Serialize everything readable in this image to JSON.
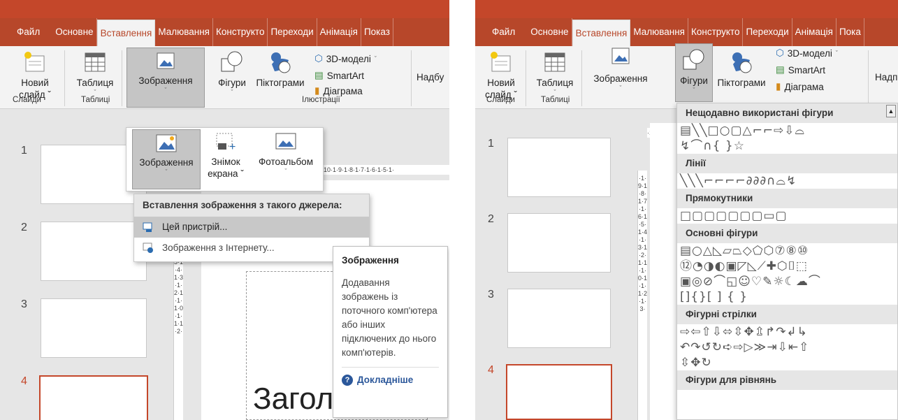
{
  "left": {
    "tabs": [
      "Файл",
      "Основне",
      "Вставлення",
      "Малювання",
      "Конструкто",
      "Переходи",
      "Анімація",
      "Показ"
    ],
    "ribbon": {
      "new_slide": {
        "label": "Новий",
        "label2": "слайд ˇ"
      },
      "table": {
        "label": "Таблиця"
      },
      "images": {
        "label": "Зображення"
      },
      "shapes": {
        "label": "Фігури"
      },
      "icons": {
        "label": "Піктограми"
      },
      "models3d": "3D-моделі",
      "smartart": "SmartArt",
      "chart": "Діаграма",
      "addins": "Надбу",
      "group_slides": "Слайди",
      "group_tables": "Таблиці",
      "group_illustrations": "Ілюстрації"
    },
    "submenu": {
      "images": "Зображення",
      "screenshot": "Знімок",
      "screenshot2": "екрана ˇ",
      "album": "Фотоальбом"
    },
    "ruler_h": "·10·1·9·1·8·1·7·1·6·1·5·1·",
    "ruler_v": "5·1·4·1·3·1·2·1·1·1·0·1·1·1·2·",
    "dropdown": {
      "header": "Вставлення зображення з такого джерела:",
      "item1": "Цей пристрій...",
      "item2": "Зображення з Інтернету..."
    },
    "tooltip": {
      "title": "Зображення",
      "body": "Додавання зображень із поточного комп'ютера або інших підключених до нього комп'ютерів.",
      "more": "Докладніше"
    },
    "slides": [
      "1",
      "2",
      "3",
      "4"
    ],
    "slide_title": "Заголовок с"
  },
  "right": {
    "tabs": [
      "Файл",
      "Основне",
      "Вставлення",
      "Малювання",
      "Конструкто",
      "Переходи",
      "Анімація",
      "Пока"
    ],
    "ribbon": {
      "new_slide": {
        "label": "Новий",
        "label2": "слайд ˇ"
      },
      "table": {
        "label": "Таблиця"
      },
      "images": {
        "label": "Зображення"
      },
      "shapes": {
        "label": "Фігури"
      },
      "icons": {
        "label": "Піктограми"
      },
      "models3d": "3D-моделі",
      "smartart": "SmartArt",
      "chart": "Діаграма",
      "addins": "Надп",
      "group_slides": "Слайди",
      "group_tables": "Таблиці"
    },
    "ruler_h": "·1",
    "ruler_v": "·1·9·1·8·1·7·1·6·1·5·1·4·1·3·1·2·1·1·1·0·1·1·1·2·1·3·",
    "shapes_menu": {
      "recent": "Нещодавно використані фігури",
      "recent_row1": "▤╲╲□○▢△⌐⌐⇨⇩⌓",
      "recent_row2": "↯⌒∩{ }☆",
      "lines": "Лінії",
      "lines_row": "╲╲╲⌐⌐⌐⌐∂∂∂∩⌓↯",
      "rects": "Прямокутники",
      "rects_row": "□▢▢▢▢▢▢▭▢",
      "basic": "Основні фігури",
      "basic_row1": "▤○△◺▱⏢◇⬠⬡⑦⑧⑩",
      "basic_row2": "⑫◔◑◐▣◸◺⟋✚⬡⌷⬚",
      "basic_row3": "▣◎⊘⌒◱☺♡✎☼☾☁⌒",
      "basic_row4": "[]{}[ ] { }",
      "arrows": "Фігурні стрілки",
      "arrows_row1": "⇨⇦⇧⇩⬄⇳✥⇫↱↷↲↳",
      "arrows_row2": "↶↷↺↻➪⇨▷≫⇥⇩⇤⇧",
      "arrows_row3": "⇳✥↻",
      "equations": "Фігури для рівнянь"
    },
    "slides": [
      "1",
      "2",
      "3",
      "4"
    ],
    "slide_title_fragment": "C"
  }
}
